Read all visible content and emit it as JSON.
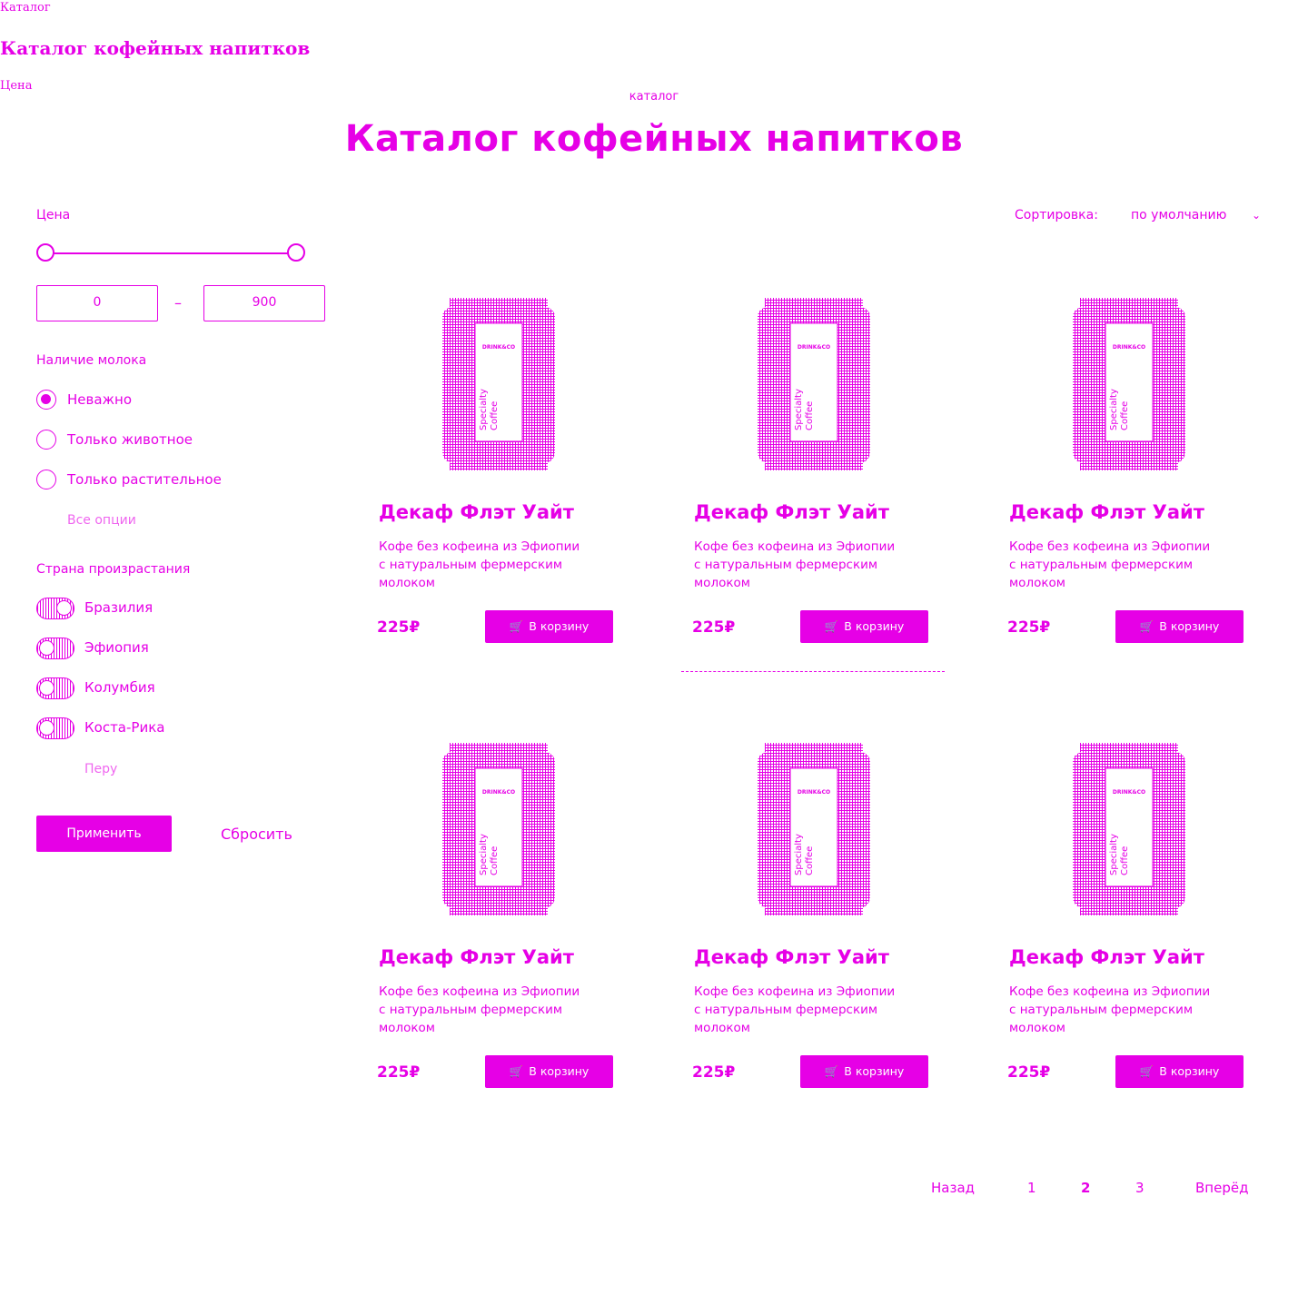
{
  "fallback": {
    "breadcrumb": "Каталог",
    "title": "Каталог кофейных напитков",
    "price_label": "Цена"
  },
  "header": {
    "eyebrow": "каталог",
    "title": "Каталог кофейных напитков"
  },
  "sidebar": {
    "price_label": "Цена",
    "price_min": "0",
    "price_max": "900",
    "price_separator": "–",
    "milk_title": "Наличие молока",
    "milk_options": [
      {
        "label": "Неважно",
        "selected": true
      },
      {
        "label": "Только животное",
        "selected": false
      },
      {
        "label": "Только растительное",
        "selected": false
      }
    ],
    "milk_show_all": "Все опции",
    "country_title": "Страна произрастания",
    "countries": [
      {
        "label": "Бразилия",
        "on": true
      },
      {
        "label": "Эфиопия",
        "on": false
      },
      {
        "label": "Колумбия",
        "on": false
      },
      {
        "label": "Коста-Рика",
        "on": false
      }
    ],
    "country_show_all": "Перу",
    "apply_label": "Применить",
    "reset_label": "Сбросить"
  },
  "sort": {
    "label": "Сортировка:",
    "value": "по умолчанию",
    "chevron_icon": "chevron-down-icon"
  },
  "can_label": {
    "brand": "DRINK&CO",
    "line1": "Specialty",
    "line2": "Coffee"
  },
  "products": [
    {
      "name": "Декаф Флэт Уайт",
      "desc_line1": "Кофе без кофеина из Эфиопии",
      "desc_line2": "с натуральным фермерским",
      "desc_line3": "молоком",
      "price": "225₽",
      "cart_label": "В корзину"
    },
    {
      "name": "Декаф Флэт Уайт",
      "desc_line1": "Кофе без кофеина из Эфиопии",
      "desc_line2": "с натуральным фермерским",
      "desc_line3": "молоком",
      "price": "225₽",
      "cart_label": "В корзину"
    },
    {
      "name": "Декаф Флэт Уайт",
      "desc_line1": "Кофе без кофеина из Эфиопии",
      "desc_line2": "с натуральным фермерским",
      "desc_line3": "молоком",
      "price": "225₽",
      "cart_label": "В корзину"
    },
    {
      "name": "Декаф Флэт Уайт",
      "desc_line1": "Кофе без кофеина из Эфиопии",
      "desc_line2": "с натуральным фермерским",
      "desc_line3": "молоком",
      "price": "225₽",
      "cart_label": "В корзину"
    },
    {
      "name": "Декаф Флэт Уайт",
      "desc_line1": "Кофе без кофеина из Эфиопии",
      "desc_line2": "с натуральным фермерским",
      "desc_line3": "молоком",
      "price": "225₽",
      "cart_label": "В корзину"
    },
    {
      "name": "Декаф Флэт Уайт",
      "desc_line1": "Кофе без кофеина из Эфиопии",
      "desc_line2": "с натуральным фермерским",
      "desc_line3": "молоком",
      "price": "225₽",
      "cart_label": "В корзину"
    }
  ],
  "pagination": {
    "prev": "Назад",
    "pages": [
      "1",
      "2",
      "3"
    ],
    "current": "2",
    "next": "Вперёд"
  },
  "colors": {
    "accent": "#e600e6",
    "background": "#ffffff"
  }
}
